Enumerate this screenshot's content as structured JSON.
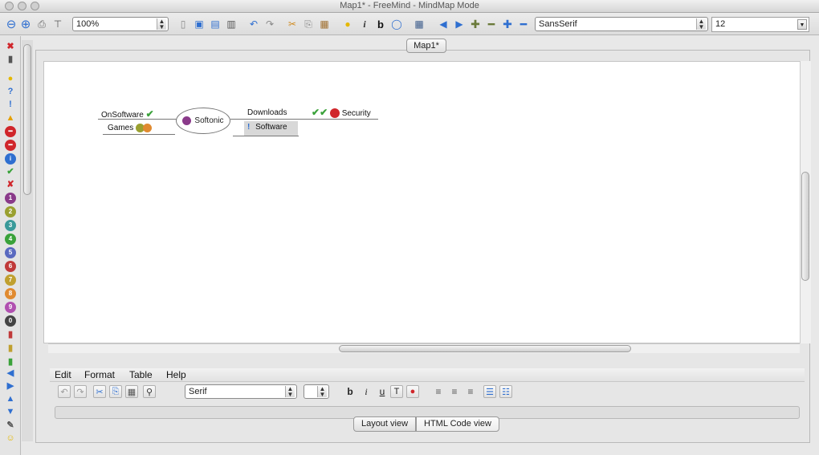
{
  "window": {
    "title": "Map1* - FreeMind - MindMap Mode"
  },
  "toolbar": {
    "zoom_value": "100%",
    "font_family_value": "SansSerif",
    "font_size_value": "12"
  },
  "tab": {
    "label": "Map1*"
  },
  "mindmap": {
    "root": "Softonic",
    "left_nodes": [
      "OnSoftware",
      "Games"
    ],
    "right_nodes": [
      "Downloads",
      "Software",
      "Security"
    ]
  },
  "note_editor": {
    "menus": [
      "Edit",
      "Format",
      "Table",
      "Help"
    ],
    "font_value": "Serif",
    "font_size_value": "",
    "views": [
      "Layout view",
      "HTML Code view"
    ]
  },
  "colors": {
    "accent_blue": "#2f6fd0",
    "ok_green": "#3aa23a",
    "stop_red": "#d0262b",
    "selected_node_bg": "#d8d8d8"
  }
}
